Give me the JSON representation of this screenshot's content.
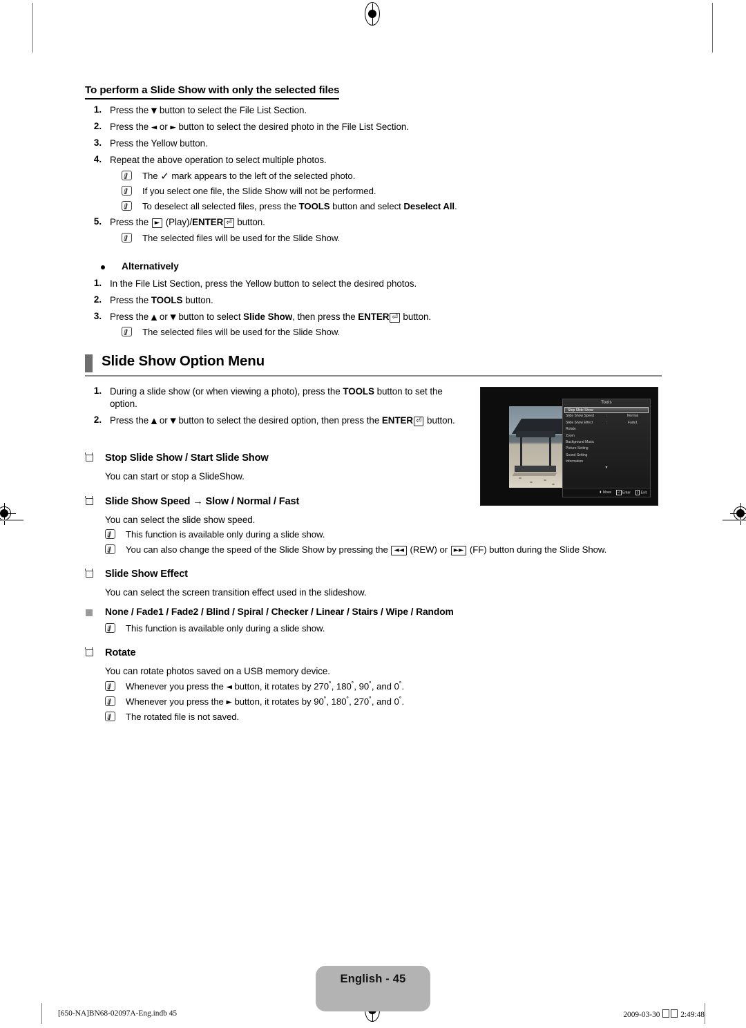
{
  "section1": {
    "title": "To perform a Slide Show with only the selected files",
    "steps": [
      {
        "n": "1.",
        "text_pre": "Press the ",
        "glyph": "▼",
        "text_post": " button to select the File List Section."
      },
      {
        "n": "2.",
        "text": "Press the ◄ or ► button to select the desired photo in the File List Section."
      },
      {
        "n": "3.",
        "text": "Press the Yellow button."
      },
      {
        "n": "4.",
        "text": "Repeat the above operation to select multiple photos."
      }
    ],
    "notes_after_4": [
      "The ✓ mark appears to the left of the selected photo.",
      "If you select one file, the Slide Show will not be performed.",
      "To deselect all selected files, press the TOOLS button and select Deselect All."
    ],
    "step5": {
      "n": "5.",
      "text": "Press the ► (Play)/ENTER⏎ button."
    },
    "note_after_5": "The selected files will be used for the Slide Show."
  },
  "alternatively": {
    "heading": "Alternatively",
    "steps": [
      {
        "n": "1.",
        "text": "In the File List Section, press the Yellow button to select the desired photos."
      },
      {
        "n": "2.",
        "text": "Press the TOOLS button."
      },
      {
        "n": "3.",
        "text": "Press the ▲ or ▼ button to select Slide Show, then press the ENTER⏎ button."
      }
    ],
    "note": "The selected files will be used for the Slide Show."
  },
  "option_menu": {
    "heading": "Slide Show Option Menu",
    "steps": [
      {
        "n": "1.",
        "text": "During a slide show (or when viewing a photo), press the TOOLS button to set the option."
      },
      {
        "n": "2.",
        "text": "Press the ▲ or ▼ button to select the desired option, then press the ENTER⏎ button."
      }
    ]
  },
  "tv_screenshot": {
    "panel_title": "Tools",
    "items": [
      {
        "label": "Stop Slide Show",
        "value": "",
        "selected": true
      },
      {
        "label": "Slide Show Speed",
        "value": "Normal",
        "selected": false
      },
      {
        "label": "Slide Show Effect",
        "value": "Fade1",
        "selected": false
      },
      {
        "label": "Rotate",
        "value": "",
        "selected": false
      },
      {
        "label": "Zoom",
        "value": "",
        "selected": false
      },
      {
        "label": "Background Music",
        "value": "",
        "selected": false
      },
      {
        "label": "Picture Setting",
        "value": "",
        "selected": false
      },
      {
        "label": "Sound Setting",
        "value": "",
        "selected": false
      },
      {
        "label": "Information",
        "value": "",
        "selected": false
      }
    ],
    "scroll_indicator": "▼",
    "footer": {
      "move": "Move",
      "enter": "Enter",
      "exit": "Exit"
    }
  },
  "sections": [
    {
      "heading": "Stop Slide Show / Start Slide Show",
      "body": "You can start or stop a SlideShow.",
      "notes": []
    },
    {
      "heading": "Slide Show Speed → Slow / Normal / Fast",
      "body": "You can select the slide show speed.",
      "notes": [
        "This function is available only during a slide show.",
        "You can also change the speed of the Slide Show by pressing the ◄◄ (REW) or ►► (FF) button during the Slide Show."
      ]
    },
    {
      "heading": "Slide Show Effect",
      "body": "You can select the screen transition effect used in the slideshow.",
      "sub_heading": "None / Fade1 / Fade2 / Blind / Spiral / Checker / Linear / Stairs / Wipe / Random",
      "sub_note": "This function is available only during a slide show."
    },
    {
      "heading": "Rotate",
      "body": "You can rotate photos saved on a USB memory device.",
      "notes": [
        "Whenever you press the ◄ button, it rotates by 270˚, 180˚, 90˚, and 0˚.",
        "Whenever you press the ► button, it rotates by 90˚, 180˚, 270˚, and 0˚.",
        "The rotated file is not saved."
      ]
    }
  ],
  "footer": {
    "page_label": "English - 45",
    "left": "[650-NA]BN68-02097A-Eng.indb   45",
    "right_date": "2009-03-30",
    "right_time": "2:49:48"
  }
}
